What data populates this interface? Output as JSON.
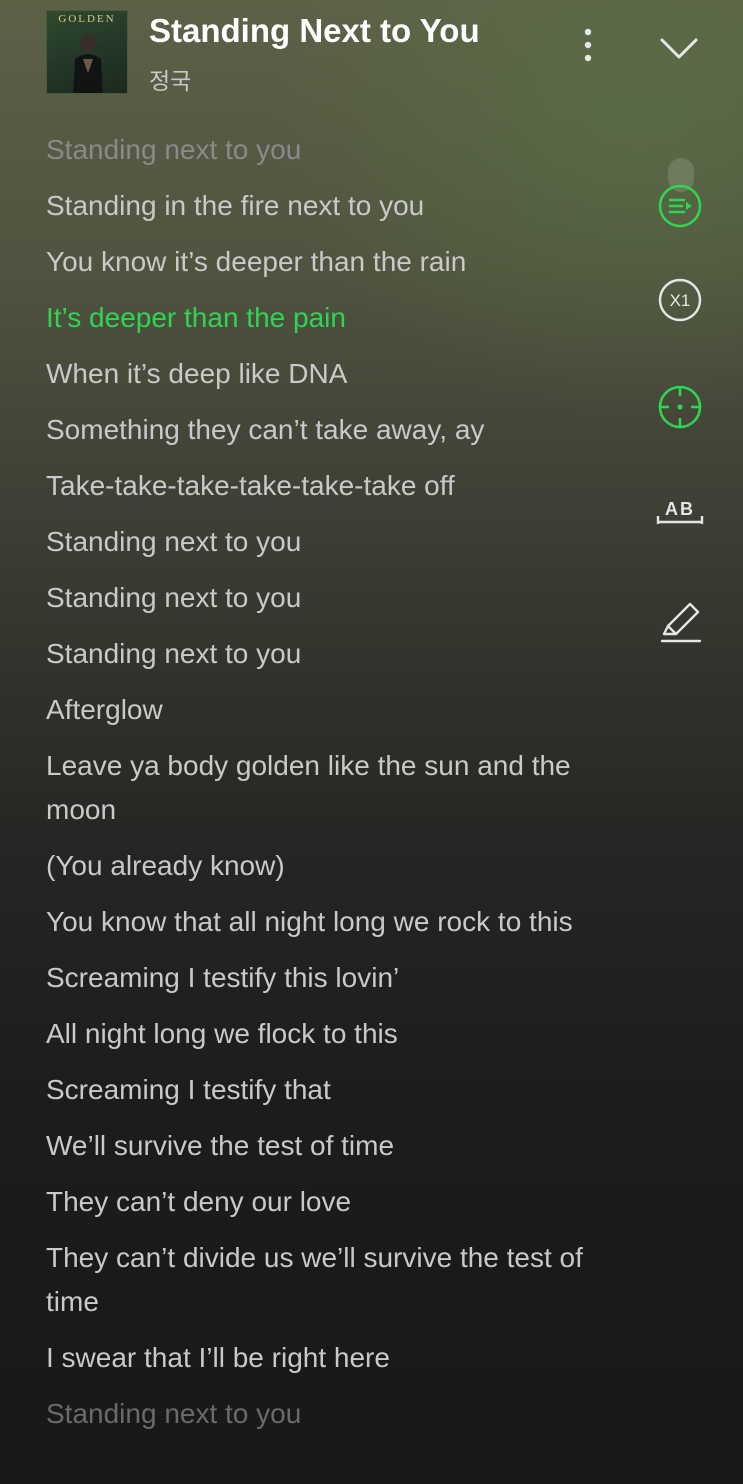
{
  "header": {
    "album_art_text": "GOLDEN",
    "title": "Standing Next to You",
    "artist": "정국"
  },
  "lyrics": [
    {
      "text": "Standing next to you",
      "state": "faded"
    },
    {
      "text": "Standing in the fire next to you",
      "state": "normal"
    },
    {
      "text": "You know it’s deeper than the rain",
      "state": "normal"
    },
    {
      "text": "It’s deeper than the pain",
      "state": "active"
    },
    {
      "text": "When it’s deep like DNA",
      "state": "normal"
    },
    {
      "text": "Something they can’t take away, ay",
      "state": "normal"
    },
    {
      "text": "Take-take-take-take-take-take off",
      "state": "normal"
    },
    {
      "text": "Standing next to you",
      "state": "normal"
    },
    {
      "text": "Standing next to you",
      "state": "normal"
    },
    {
      "text": "Standing next to you",
      "state": "normal"
    },
    {
      "text": "Afterglow",
      "state": "normal"
    },
    {
      "text": "Leave ya body golden like the sun and the moon",
      "state": "normal"
    },
    {
      "text": "(You already know)",
      "state": "normal"
    },
    {
      "text": "You know that all night long we rock to this",
      "state": "normal"
    },
    {
      "text": "Screaming I testify this lovin’",
      "state": "normal"
    },
    {
      "text": "All night long we flock to this",
      "state": "normal"
    },
    {
      "text": "Screaming I testify that",
      "state": "normal"
    },
    {
      "text": "We’ll survive the test of time",
      "state": "normal"
    },
    {
      "text": "They can’t deny our love",
      "state": "normal"
    },
    {
      "text": "They can’t divide us we’ll survive the test of time",
      "state": "normal"
    },
    {
      "text": "I swear that I’ll be right here",
      "state": "normal"
    },
    {
      "text": "Standing next to you",
      "state": "dim-bottom"
    }
  ],
  "controls": {
    "speed_label": "X1",
    "ab_label": "AB"
  },
  "colors": {
    "accent_green": "#2fd552",
    "lyric_text": "#c9c9c9",
    "lyric_faded": "#8a8a8a"
  },
  "icons": {
    "more": "more-vertical-icon",
    "collapse": "chevron-down-icon",
    "autoscroll": "autoscroll-icon",
    "speed": "speed-x1-icon",
    "sync": "crosshair-sync-icon",
    "ab_repeat": "ab-repeat-icon",
    "highlight": "highlighter-icon"
  }
}
